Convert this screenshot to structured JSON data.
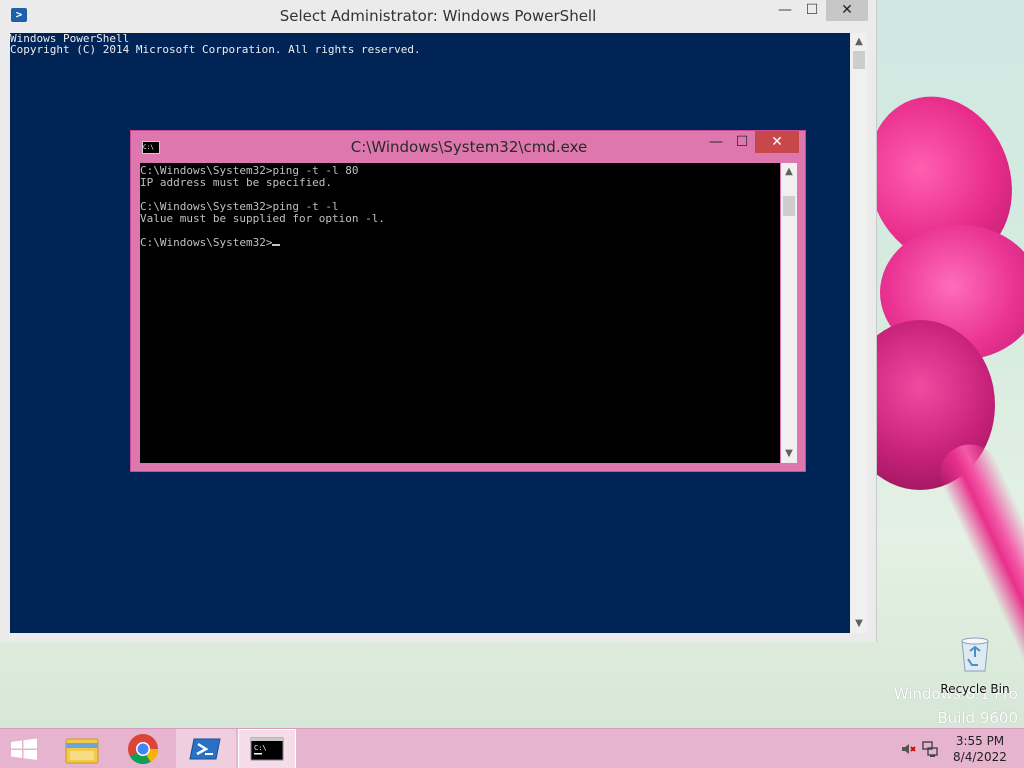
{
  "powershell": {
    "title": "Select Administrator: Windows PowerShell",
    "lines": [
      "Windows PowerShell",
      "Copyright (C) 2014 Microsoft Corporation. All rights reserved."
    ],
    "controls": {
      "minimize": "—",
      "maximize": "☐",
      "close": "✕"
    }
  },
  "cmd": {
    "title": "C:\\Windows\\System32\\cmd.exe",
    "lines": [
      "C:\\Windows\\System32>ping -t -l 80",
      "IP address must be specified.",
      "",
      "C:\\Windows\\System32>ping -t -l",
      "Value must be supplied for option -l.",
      "",
      "C:\\Windows\\System32>"
    ],
    "controls": {
      "minimize": "—",
      "maximize": "☐",
      "close": "✕"
    }
  },
  "desktop": {
    "recycle_bin_label": "Recycle Bin",
    "watermark_line1": "Windows 8.1 Pro",
    "watermark_line2": "Build 9600"
  },
  "taskbar": {
    "pinned": [
      "start-icon",
      "file-explorer-icon",
      "chrome-icon",
      "powershell-icon",
      "cmd-icon"
    ],
    "clock_time": "3:55 PM",
    "clock_date": "8/4/2022"
  },
  "colors": {
    "ps_background": "#012456",
    "cmd_frame": "#de77ae",
    "close_hover": "#c7474b",
    "taskbar": "#e7b4cf"
  }
}
